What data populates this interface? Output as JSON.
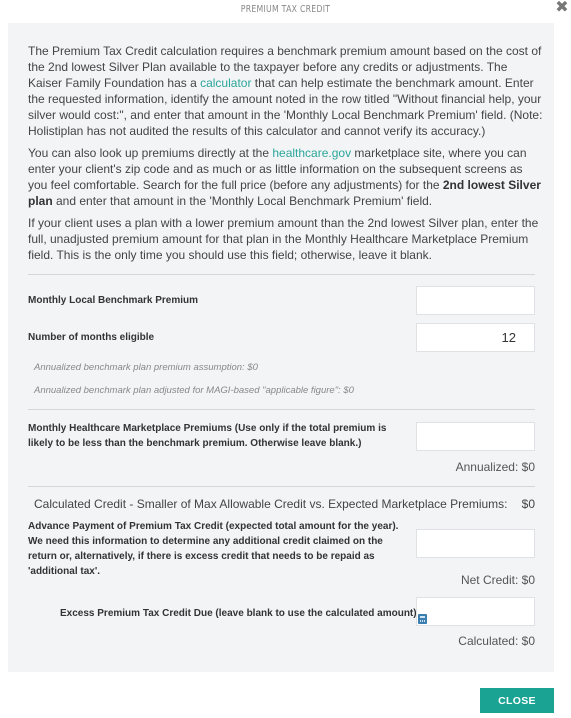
{
  "modal": {
    "title": "PREMIUM TAX CREDIT",
    "close_icon": "close-x-icon"
  },
  "intro": {
    "p1_before_link": "The Premium Tax Credit calculation requires a benchmark premium amount based on the cost of the 2nd lowest Silver Plan available to the taxpayer before any credits or adjustments. The Kaiser Family Foundation has a ",
    "p1_link": "calculator",
    "p1_after_link": " that can help estimate the benchmark amount. Enter the requested information, identify the amount noted in the row titled \"Without financial help, your silver would cost:\", and enter that amount in the 'Monthly Local Benchmark Premium' field. (Note: Holistiplan has not audited the results of this calculator and cannot verify its accuracy.)",
    "p2_before_link": "You can also look up premiums directly at the ",
    "p2_link": "healthcare.gov",
    "p2_middle": " marketplace site, where you can enter your client's zip code and as much or as little information on the subsequent screens as you feel comfortable. Search for the full price (before any adjustments) for the ",
    "p2_bold": "2nd lowest Silver plan",
    "p2_after_bold": " and enter that amount in the 'Monthly Local Benchmark Premium' field.",
    "p3": "If your client uses a plan with a lower premium amount than the 2nd lowest Silver plan, enter the full, unadjusted premium amount for that plan in the Monthly Healthcare Marketplace Premium field. This is the only time you should use this field; otherwise, leave it blank."
  },
  "fields": {
    "benchmark": {
      "label": "Monthly Local Benchmark Premium",
      "value": ""
    },
    "months": {
      "label": "Number of months eligible",
      "value": "12"
    },
    "marketplace": {
      "label": "Monthly Healthcare Marketplace Premiums (Use only if the total premium is likely to be less than the benchmark premium. Otherwise leave blank.)",
      "value": ""
    },
    "advance": {
      "label": "Advance Payment of Premium Tax Credit (expected total amount for the year). We need this information to determine any additional credit claimed on the return or, alternatively, if there is excess credit that needs to be repaid as 'additional tax'.",
      "value": ""
    },
    "excess": {
      "label": "Excess Premium Tax Credit Due (leave blank to use the calculated amount):",
      "value": ""
    }
  },
  "notes": {
    "annualized_assumption": "Annualized benchmark plan premium assumption:  $0",
    "annualized_magi": "Annualized benchmark plan adjusted for MAGI-based \"applicable figure\":  $0"
  },
  "results": {
    "annualized": "Annualized:  $0",
    "calculated_credit_label": "Calculated Credit - Smaller of Max Allowable Credit vs. Expected Marketplace Premiums:",
    "calculated_credit_value": "$0",
    "net_credit": "Net Credit:  $0",
    "calculated": "Calculated:  $0",
    "calc_icon": "calculator-icon"
  },
  "footer": {
    "close_label": "CLOSE"
  },
  "colors": {
    "accent": "#1aa393",
    "link": "#2aa69a",
    "panel_bg": "#f3f4f6",
    "icon_blue": "#3b7dae"
  }
}
